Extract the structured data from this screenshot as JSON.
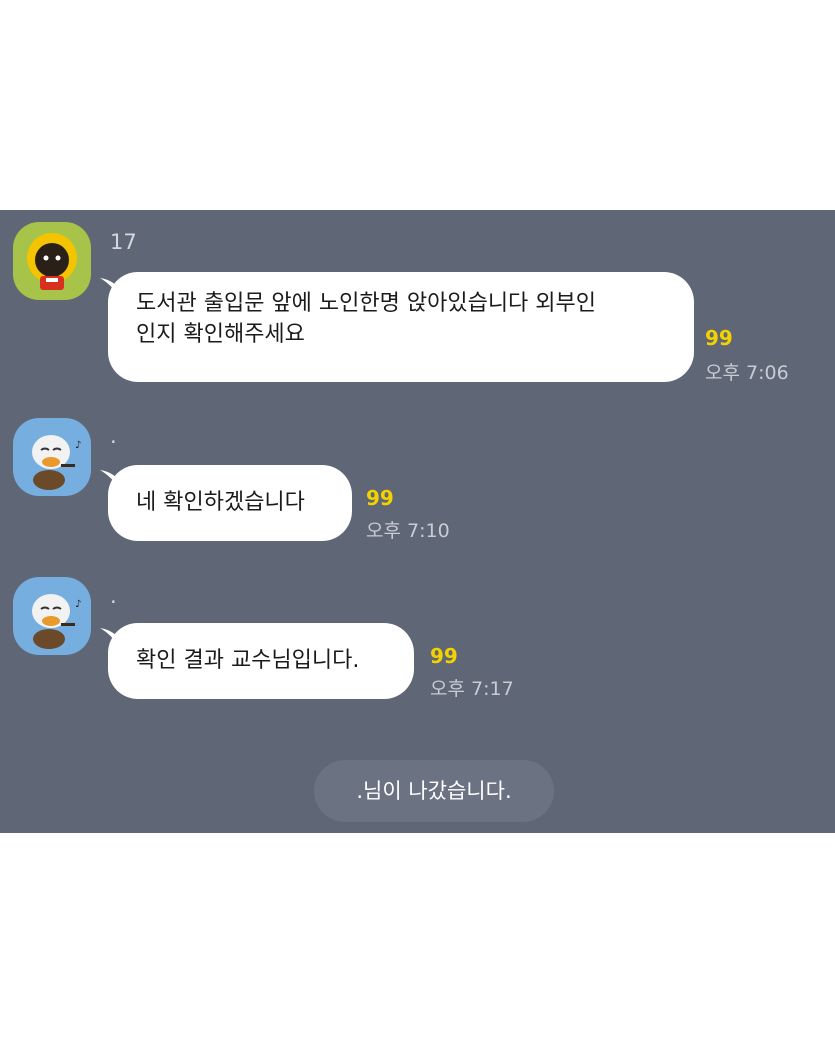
{
  "messages": [
    {
      "sender": "17",
      "avatar_icon": "afro-character-avatar-icon",
      "text_line1": "도서관 출입문 앞에 노인한명 앉아있습니다 외부인",
      "text_line2": "인지 확인해주세요",
      "unread_count": "99",
      "time": "오후 7:06"
    },
    {
      "sender": ".",
      "avatar_icon": "guitar-character-avatar-icon",
      "text": "네 확인하겠습니다",
      "unread_count": "99",
      "time": "오후 7:10"
    },
    {
      "sender": ".",
      "avatar_icon": "guitar-character-avatar-icon",
      "text": "확인 결과 교수님입니다.",
      "unread_count": "99",
      "time": "오후 7:17"
    }
  ],
  "system_notice": ".님이 나갔습니다.",
  "colors": {
    "chat_background": "#5f6675",
    "bubble": "#ffffff",
    "unread": "#f2d200",
    "notice_pill": "#6b7282"
  }
}
